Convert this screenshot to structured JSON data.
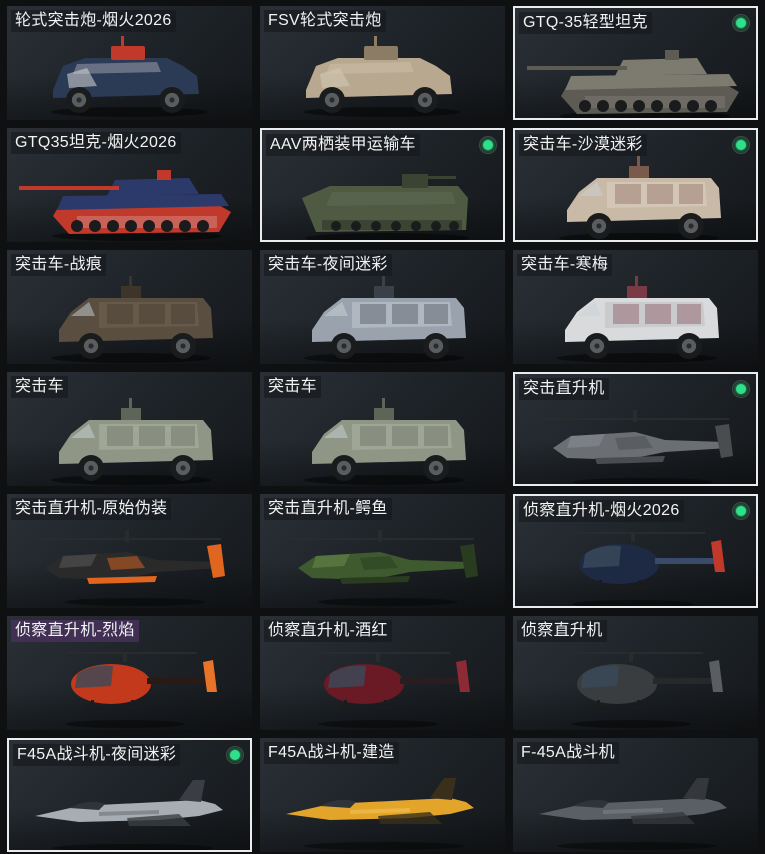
{
  "vehicles": [
    {
      "name": "轮式突击炮-烟火2026",
      "type": "apc",
      "colors": [
        "#2b3a55",
        "#c0392b",
        "#d9d9d9"
      ],
      "selected": false,
      "status": false,
      "label_style": "dark"
    },
    {
      "name": "FSV轮式突击炮",
      "type": "apc",
      "colors": [
        "#b8a890",
        "#8c7c66",
        "#d6cbb6"
      ],
      "selected": false,
      "status": false,
      "label_style": "dark"
    },
    {
      "name": "GTQ-35轻型坦克",
      "type": "tank",
      "colors": [
        "#7d7a70",
        "#5d5b54",
        "#a09c92"
      ],
      "selected": true,
      "status": true,
      "label_style": "dark"
    },
    {
      "name": "GTQ35坦克-烟火2026",
      "type": "tank",
      "colors": [
        "#2b3a6b",
        "#c0392b",
        "#e5e5e5"
      ],
      "selected": false,
      "status": false,
      "label_style": "dark"
    },
    {
      "name": "AAV两栖装甲运输车",
      "type": "amphib",
      "colors": [
        "#4f5a43",
        "#3b4433",
        "#6a7560"
      ],
      "selected": true,
      "status": true,
      "label_style": "dark"
    },
    {
      "name": "突击车-沙漠迷彩",
      "type": "truck",
      "colors": [
        "#c9b9a7",
        "#7a5a4a",
        "#e2d8cc"
      ],
      "selected": true,
      "status": true,
      "label_style": "dark"
    },
    {
      "name": "突击车-战痕",
      "type": "truck",
      "colors": [
        "#5a4e40",
        "#3d342a",
        "#7a6a56"
      ],
      "selected": false,
      "status": false,
      "label_style": "dark"
    },
    {
      "name": "突击车-夜间迷彩",
      "type": "truck",
      "colors": [
        "#9aa3ad",
        "#3a4049",
        "#c9d0d6"
      ],
      "selected": false,
      "status": false,
      "label_style": "dark"
    },
    {
      "name": "突击车-寒梅",
      "type": "truck",
      "colors": [
        "#d9dadc",
        "#7a3a45",
        "#b5b7ba"
      ],
      "selected": false,
      "status": false,
      "label_style": "dark"
    },
    {
      "name": "突击车",
      "type": "truck",
      "colors": [
        "#8f9686",
        "#5e6458",
        "#b4baa9"
      ],
      "selected": false,
      "status": false,
      "label_style": "dark"
    },
    {
      "name": "突击车",
      "type": "truck",
      "colors": [
        "#8f9686",
        "#5e6458",
        "#b4baa9"
      ],
      "selected": false,
      "status": false,
      "label_style": "dark"
    },
    {
      "name": "突击直升机",
      "type": "attack-heli",
      "colors": [
        "#6b6f73",
        "#4a4d50",
        "#8a8e92"
      ],
      "selected": true,
      "status": true,
      "label_style": "dark"
    },
    {
      "name": "突击直升机-原始伪装",
      "type": "attack-heli",
      "colors": [
        "#2a2a2a",
        "#e0661f",
        "#5a5a5a"
      ],
      "selected": false,
      "status": false,
      "label_style": "dark"
    },
    {
      "name": "突击直升机-鳄鱼",
      "type": "attack-heli",
      "colors": [
        "#3f5a2e",
        "#2a3c1f",
        "#6a8a4c"
      ],
      "selected": false,
      "status": false,
      "label_style": "dark"
    },
    {
      "name": "侦察直升机-烟火2026",
      "type": "scout-heli",
      "colors": [
        "#1e2a44",
        "#3a4a6a",
        "#c0392b"
      ],
      "selected": true,
      "status": true,
      "label_style": "dark"
    },
    {
      "name": "侦察直升机-烈焰",
      "type": "scout-heli",
      "colors": [
        "#c2391b",
        "#2a1a16",
        "#e8742a"
      ],
      "selected": false,
      "status": false,
      "label_style": "purple"
    },
    {
      "name": "侦察直升机-酒红",
      "type": "scout-heli",
      "colors": [
        "#6a1a24",
        "#2a1d20",
        "#8c2a36"
      ],
      "selected": false,
      "status": false,
      "label_style": "dark"
    },
    {
      "name": "侦察直升机",
      "type": "scout-heli",
      "colors": [
        "#3a3d40",
        "#26282a",
        "#5a5e62"
      ],
      "selected": false,
      "status": false,
      "label_style": "dark"
    },
    {
      "name": "F45A战斗机-夜间迷彩",
      "type": "jet",
      "colors": [
        "#a8adb3",
        "#3a3e44",
        "#6c7178"
      ],
      "selected": true,
      "status": true,
      "label_style": "dark"
    },
    {
      "name": "F45A战斗机-建造",
      "type": "jet",
      "colors": [
        "#e2a52a",
        "#3a2f1a",
        "#f0c256"
      ],
      "selected": false,
      "status": false,
      "label_style": "dark"
    },
    {
      "name": "F-45A战斗机",
      "type": "jet",
      "colors": [
        "#5a5f65",
        "#34383c",
        "#7c8188"
      ],
      "selected": false,
      "status": false,
      "label_style": "dark"
    }
  ]
}
